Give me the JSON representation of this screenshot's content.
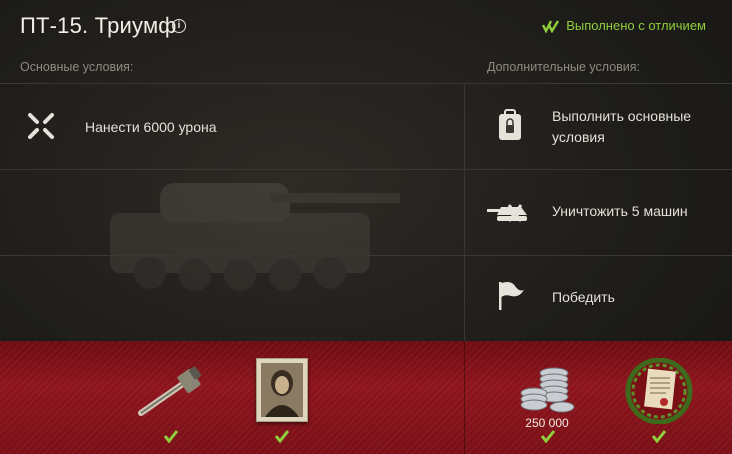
{
  "header": {
    "title": "ПТ-15. Триумф",
    "info_icon": "info-icon",
    "status_text": "Выполнено с отличием",
    "status_color": "#8fcf3c"
  },
  "main_conditions": {
    "label": "Основные условия:",
    "items": [
      {
        "icon": "crosshair-arrows-icon",
        "text": "Нанести 6000 урона"
      }
    ]
  },
  "extra_conditions": {
    "label": "Дополнительные условия:",
    "items": [
      {
        "icon": "clipboard-lock-icon",
        "text": "Выполнить основные условия"
      },
      {
        "icon": "destroyed-tank-icon",
        "text": "Уничтожить 5 машин"
      },
      {
        "icon": "flag-icon",
        "text": "Победить"
      }
    ]
  },
  "rewards": {
    "main": [
      {
        "icon": "gun-barrel-icon",
        "completed": true
      },
      {
        "icon": "crew-portrait-icon",
        "completed": true
      }
    ],
    "extra": [
      {
        "icon": "silver-coins-icon",
        "amount": "250 000",
        "completed": true
      },
      {
        "icon": "award-document-icon",
        "completed": true
      }
    ],
    "accent": "#8e141c"
  }
}
